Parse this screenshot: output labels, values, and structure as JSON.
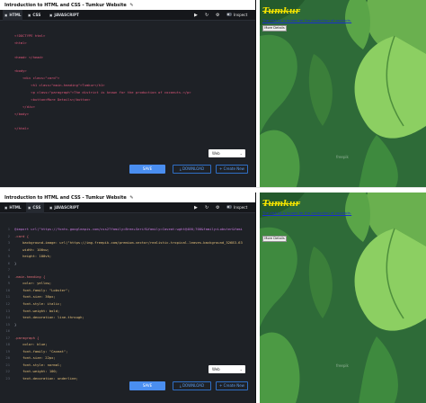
{
  "window_title": "Introduction to HTML and CSS - Tumkur Website",
  "tabs": {
    "html": "HTML",
    "css": "CSS",
    "js": "JAVASCRIPT"
  },
  "toolbar": {
    "inspect": "Inspect"
  },
  "theme_select": "Web",
  "buttons": {
    "save": "SAVE",
    "download": "DOWNLOAD",
    "create_new": "+ Create New"
  },
  "preview": {
    "heading": "Tumkur",
    "paragraph": "The district is known for the production of coconuts.",
    "button": "More Details",
    "watermark": "freepik"
  },
  "html_code": [
    "<!DOCTYPE html>",
    "<html>",
    "",
    "<head> </head>",
    "",
    "<body>",
    "    <div class=\"card\">",
    "        <h1 class=\"main-heading\">Tumkur</h1>",
    "        <p class=\"paragraph\">The district is known for the production of coconuts.</p>",
    "        <button>More Details</button>",
    "    </div>",
    "</body>",
    "",
    "</html>"
  ],
  "css_code": [
    "@import url(\"https://fonts.googleapis.com/css2?family=Bree+Serif&family=Caveat:wght@400;700&family=Lobster&fami",
    ".card {",
    "    background-image: url(\"https://img.freepik.com/premium-vector/realistic-tropical-leaves-background_52683-63",
    "    width: 100vw;",
    "    height: 100vh;",
    "}",
    "",
    ".main-heading {",
    "    color: yellow;",
    "    font-family: \"Lobster\";",
    "    font-size: 36px;",
    "    font-style: italic;",
    "    font-weight: bold;",
    "    text-decoration: line-through;",
    "}",
    "",
    ".paragraph {",
    "    color: blue;",
    "    font-family: \"Caveat\";",
    "    font-size: 22px;",
    "    font-style: normal;",
    "    font-weight: 100;",
    "    text-decoration: underline;"
  ],
  "css_line_numbers": [
    "1",
    "2",
    "3",
    "4",
    "5",
    "6",
    "7",
    "8",
    "9",
    "10",
    "11",
    "12",
    "13",
    "14",
    "15",
    "16",
    "17",
    "18",
    "19",
    "20",
    "21",
    "22",
    "23"
  ],
  "colors": {
    "editor_bg": "#1e2126",
    "accent": "#4a8ef0",
    "heading": "#f5e400",
    "paragraph": "#1a2fd0"
  }
}
